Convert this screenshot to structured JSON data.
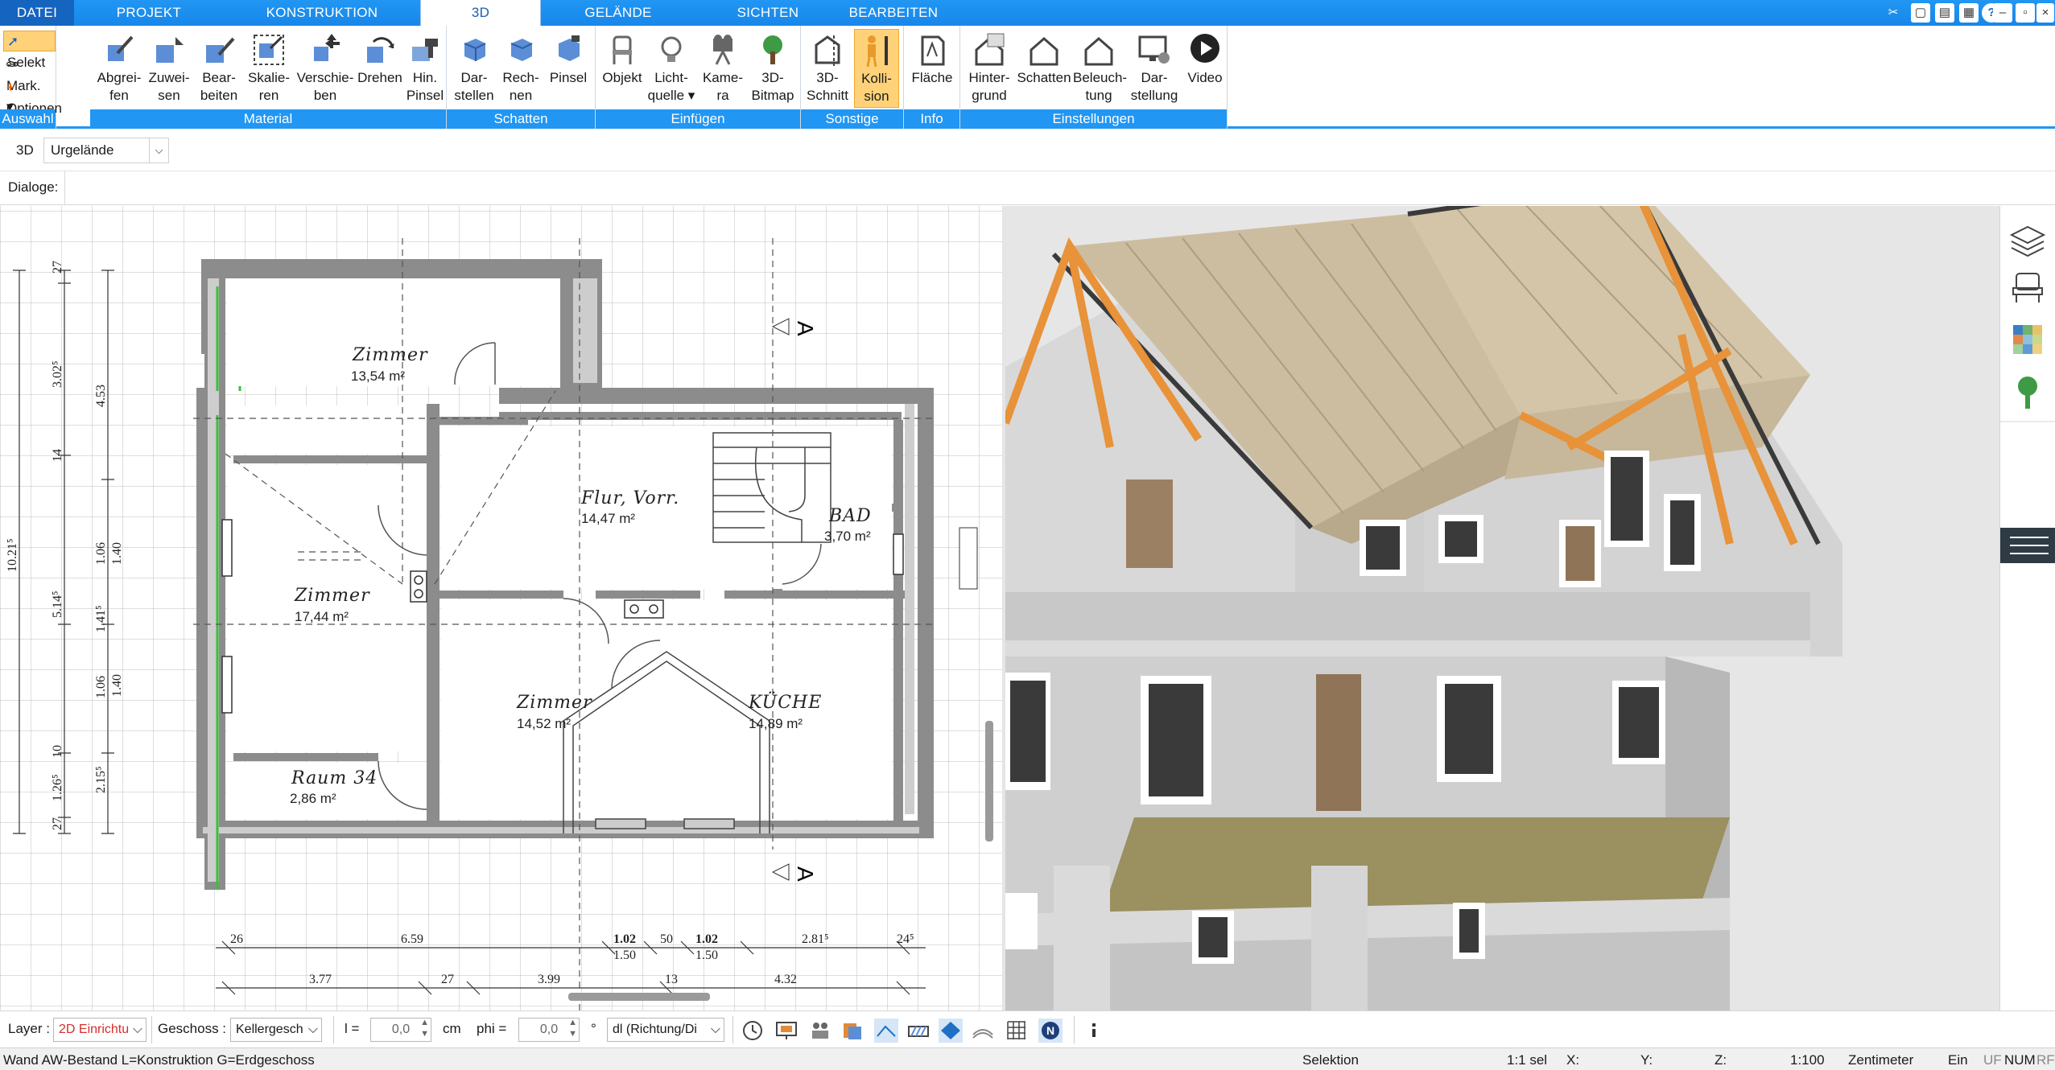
{
  "menu": {
    "tabs": [
      "DATEI",
      "PROJEKT",
      "KONSTRUKTION",
      "3D",
      "GELÄNDE",
      "SICHTEN",
      "BEARBEITEN"
    ],
    "active": "3D"
  },
  "ribbon": {
    "auswahl": {
      "label": "Auswahl",
      "selekt": "Selekt",
      "mark": "Mark.",
      "optionen": "Optionen"
    },
    "material": {
      "label": "Material",
      "buttons": [
        {
          "line1": "Abgrei-",
          "line2": "fen"
        },
        {
          "line1": "Zuwei-",
          "line2": "sen"
        },
        {
          "line1": "Bear-",
          "line2": "beiten"
        },
        {
          "line1": "Skalie-",
          "line2": "ren"
        },
        {
          "line1": "Verschie-",
          "line2": "ben"
        },
        {
          "line1": "Drehen",
          "line2": ""
        },
        {
          "line1": "Hin.",
          "line2": "Pinsel"
        }
      ]
    },
    "schatten": {
      "label": "Schatten",
      "buttons": [
        {
          "line1": "Dar-",
          "line2": "stellen"
        },
        {
          "line1": "Rech-",
          "line2": "nen"
        },
        {
          "line1": "Pinsel",
          "line2": ""
        }
      ]
    },
    "einfuegen": {
      "label": "Einfügen",
      "buttons": [
        {
          "line1": "Objekt",
          "line2": ""
        },
        {
          "line1": "Licht-",
          "line2": "quelle"
        },
        {
          "line1": "Kame-",
          "line2": "ra"
        },
        {
          "line1": "3D-",
          "line2": "Bitmap"
        }
      ]
    },
    "sonstige": {
      "label": "Sonstige",
      "buttons": [
        {
          "line1": "3D-",
          "line2": "Schnitt"
        },
        {
          "line1": "Kolli-",
          "line2": "sion"
        }
      ]
    },
    "info": {
      "label": "Info",
      "buttons": [
        {
          "line1": "Fläche",
          "line2": ""
        }
      ]
    },
    "einstellungen": {
      "label": "Einstellungen",
      "buttons": [
        {
          "line1": "Hinter-",
          "line2": "grund"
        },
        {
          "line1": "Schatten",
          "line2": ""
        },
        {
          "line1": "Beleuch-",
          "line2": "tung"
        },
        {
          "line1": "Dar-",
          "line2": "stellung"
        },
        {
          "line1": "Video",
          "line2": ""
        }
      ]
    }
  },
  "view_row": {
    "mode": "3D",
    "terrain": "Urgelände"
  },
  "dialog_row": {
    "label": "Dialoge:"
  },
  "plan": {
    "rooms": [
      {
        "name": "Zimmer",
        "area": "13,54 m²"
      },
      {
        "name": "Flur, Vorr.",
        "area": "14,47 m²"
      },
      {
        "name": "BAD",
        "area": "3,70 m²"
      },
      {
        "name": "Zimmer",
        "area": "17,44 m²"
      },
      {
        "name": "Zimmer",
        "area": "14,52 m²"
      },
      {
        "name": "KÜCHE",
        "area": "14,89 m²"
      },
      {
        "name": "Raum 34",
        "area": "2,86 m²"
      }
    ],
    "section_marker": "A",
    "dims_left": [
      "27",
      "3.02⁵",
      "14",
      "5.14⁵",
      "10",
      "1.26⁵",
      "27",
      "10.21⁵",
      "4.53",
      "1.06",
      "1.41⁵",
      "1.06",
      "2.15⁵",
      "1.40",
      "1.40"
    ],
    "dims_bottom_top": [
      "26",
      "6.59",
      "1.02",
      "1.50",
      "50",
      "1.02",
      "1.50",
      "2.81⁵",
      "24⁵"
    ],
    "dims_bottom_low": [
      "3.77",
      "27",
      "3.99",
      "13",
      "4.32"
    ]
  },
  "bottombar": {
    "layer_label": "Layer :",
    "layer_value": "2D Einrichtu",
    "geschoss_label": "Geschoss :",
    "geschoss_value": "Kellergesch",
    "l_label": "l =",
    "l_value": "0,0",
    "l_unit": "cm",
    "phi_label": "phi =",
    "phi_value": "0,0",
    "phi_unit": "°",
    "direction": "dl (Richtung/Di"
  },
  "statusbar": {
    "left": "Wand AW-Bestand L=Konstruktion G=Erdgeschoss",
    "mode": "Selektion",
    "scale_sel": "1:1 sel",
    "x": "X:",
    "y": "Y:",
    "z": "Z:",
    "scale": "1:100",
    "unit": "Zentimeter",
    "ein": "Ein",
    "flags": [
      "UF",
      "NUM",
      "RF"
    ]
  },
  "colors": {
    "accent": "#2196f3",
    "active_button": "#ffd27a",
    "wall": "#9a9a9a",
    "roof": "#c8b89a",
    "rafter": "#e8923a",
    "floor": "#8b8a5a"
  }
}
